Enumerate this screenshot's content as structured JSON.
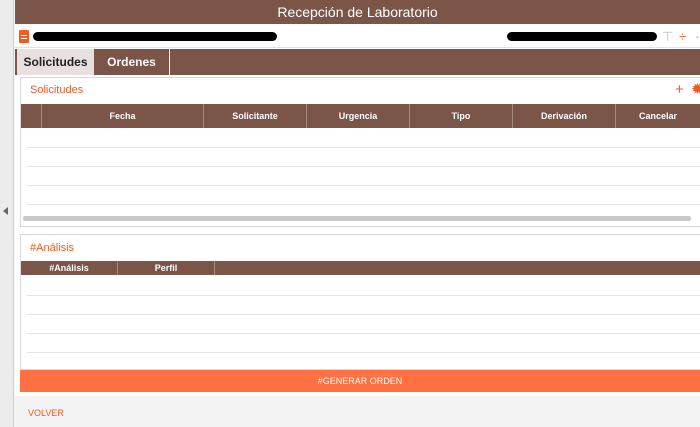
{
  "window": {
    "title": "Recepción de Laboratorio"
  },
  "tabs": [
    {
      "label": "Solicitudes",
      "active": true
    },
    {
      "label": "Ordenes",
      "active": false
    }
  ],
  "solicitudes": {
    "title": "Solicitudes",
    "columns": [
      "Fecha",
      "Solicitante",
      "Urgencia",
      "Tipo",
      "Derivación",
      "Cancelar"
    ],
    "rows": []
  },
  "analisis": {
    "title": "#Análisis",
    "columns": [
      "#Análisis",
      "Perfil"
    ],
    "rows": []
  },
  "actions": {
    "generate": "#GENERAR ORDEN",
    "back": "VOLVER"
  },
  "icons": {
    "add": "add-icon",
    "settings": "gear-icon",
    "document": "document-icon",
    "sort": "sort-icon"
  },
  "colors": {
    "header_brown": "#7a5548",
    "accent_orange": "#ee5a24",
    "button_orange": "#ff7043"
  }
}
